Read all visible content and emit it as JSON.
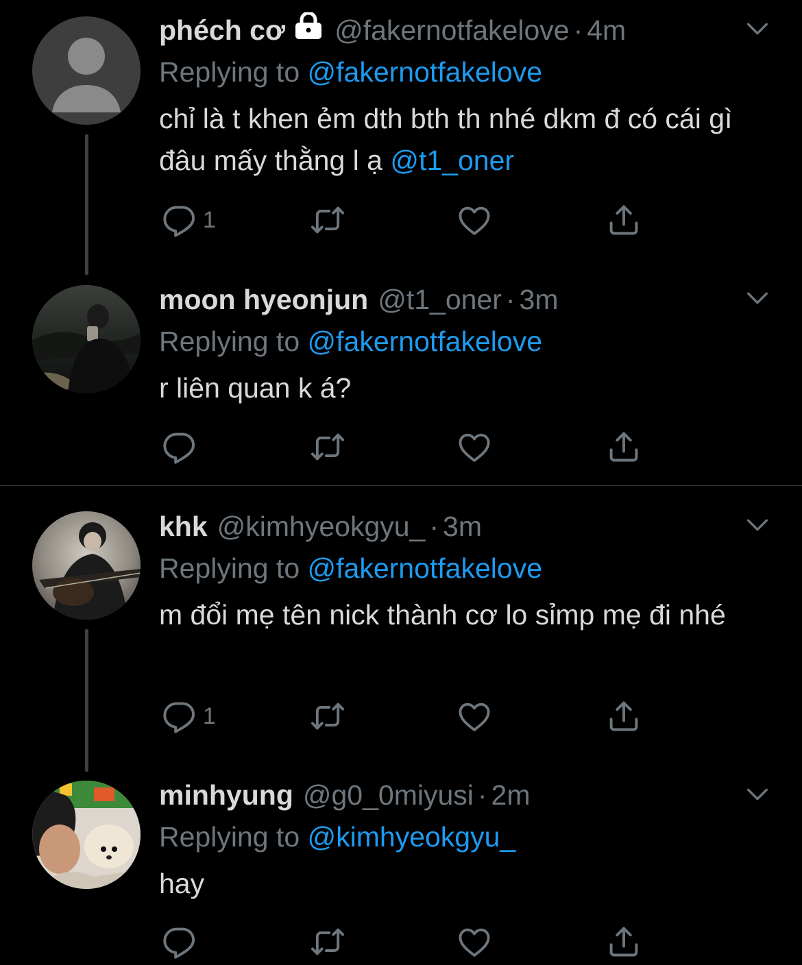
{
  "tweets": [
    {
      "name": "phéch cơ",
      "handle": "@fakernotfakelove",
      "dot": "·",
      "time": "4m",
      "replying_prefix": "Replying to ",
      "replying_to": "@fakernotfakelove",
      "text": "chỉ là t khen ẻm dth bth th nhé dkm đ có cái gì đâu mấy thằng l ạ ",
      "text_mention": "@t1_oner",
      "reply_count": "1"
    },
    {
      "name": "moon hyeonjun",
      "handle": "@t1_oner",
      "dot": "·",
      "time": "3m",
      "replying_prefix": "Replying to ",
      "replying_to": "@fakernotfakelove",
      "text": "r liên quan k á?",
      "reply_count": ""
    },
    {
      "name": "khk",
      "handle": "@kimhyeokgyu_",
      "dot": "·",
      "time": "3m",
      "replying_prefix": "Replying to ",
      "replying_to": "@fakernotfakelove",
      "text": "m đổi mẹ tên nick thành cơ lo sỉmp mẹ đi nhé",
      "reply_count": "1"
    },
    {
      "name": "minhyung",
      "handle": "@g0_0miyusi",
      "dot": "·",
      "time": "2m",
      "replying_prefix": "Replying to ",
      "replying_to": "@kimhyeokgyu_",
      "text": "hay",
      "reply_count": ""
    }
  ],
  "colors": {
    "background": "#000000",
    "text": "#d9d9d9",
    "secondary": "#6e767d",
    "link": "#1d9bf0",
    "thread_line": "#3d4145"
  },
  "icons": {
    "reply": "reply-bubble-icon",
    "retweet": "retweet-icon",
    "like": "heart-icon",
    "share": "share-icon",
    "caret": "chevron-down-icon",
    "lock": "lock-icon"
  }
}
